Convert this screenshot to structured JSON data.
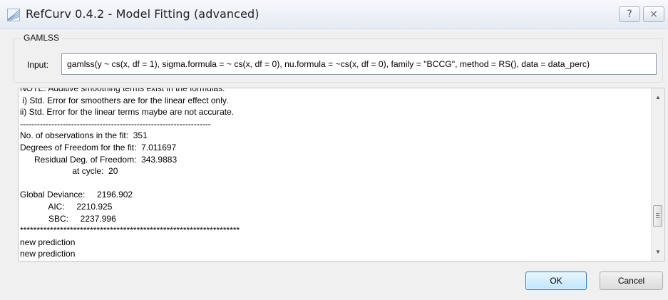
{
  "window": {
    "title": "RefCurv 0.4.2 - Model Fitting (advanced)",
    "help_glyph": "?",
    "close_glyph": "⨯",
    "app_icon": "refcurv-app-icon"
  },
  "gamlss": {
    "group_label": "GAMLSS",
    "input_label": "Input:",
    "input_value": "gamlss(y ~ cs(x, df = 1), sigma.formula = ~ cs(x, df = 0), nu.formula = ~cs(x, df = 0), family = \"BCCG\", method = RS(), data = data_perc)"
  },
  "output": {
    "lines": [
      "NOTE: Additive smoothing terms exist in the formulas:",
      " i) Std. Error for smoothers are for the linear effect only.",
      "ii) Std. Error for the linear terms maybe are not accurate.",
      "-------------------------------------------------------------------",
      "No. of observations in the fit:  351",
      "Degrees of Freedom for the fit:  7.011697",
      "      Residual Deg. of Freedom:  343.9883",
      "                      at cycle:  20",
      "",
      "Global Deviance:     2196.902",
      "            AIC:     2210.925",
      "            SBC:     2237.996",
      "******************************************************************",
      "new prediction",
      "new prediction"
    ]
  },
  "scrollbar": {
    "up_glyph": "▲",
    "down_glyph": "▼"
  },
  "buttons": {
    "ok": "OK",
    "cancel": "Cancel"
  }
}
